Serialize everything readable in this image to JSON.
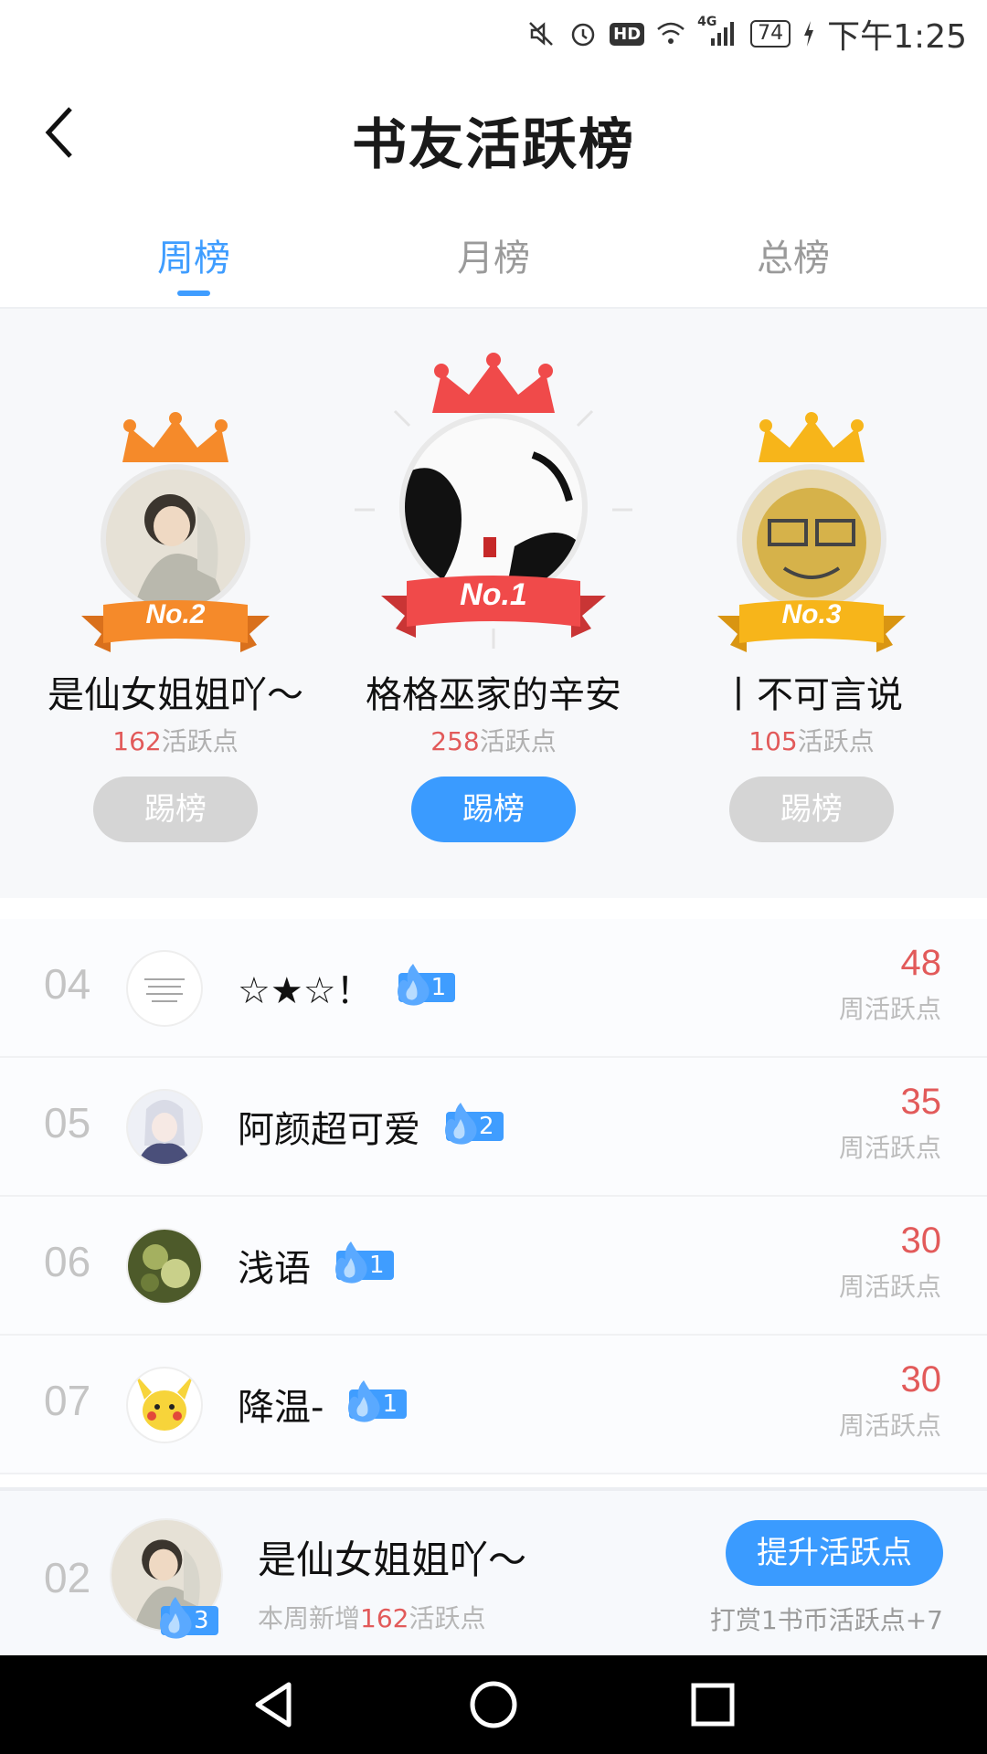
{
  "status_bar": {
    "time": "下午1:25",
    "battery": "74",
    "network": "4G",
    "hd": "HD",
    "icons": [
      "mute-icon",
      "alarm-icon",
      "hd-icon",
      "wifi-icon",
      "signal-icon",
      "battery-icon",
      "charging-icon"
    ]
  },
  "header": {
    "title": "书友活跃榜",
    "back_icon": "back-arrow-icon"
  },
  "tabs": [
    {
      "label": "周榜",
      "active": true
    },
    {
      "label": "月榜",
      "active": false
    },
    {
      "label": "总榜",
      "active": false
    }
  ],
  "podium": [
    {
      "rank_label": "No.1",
      "name": "格格巫家的辛安",
      "points": "258",
      "points_suffix": "活跃点",
      "button": "踢榜",
      "button_style": "blue",
      "crown_color": "#f04a4a",
      "ribbon_color": "#f04a4a"
    },
    {
      "rank_label": "No.2",
      "name": "是仙女姐姐吖～",
      "points": "162",
      "points_suffix": "活跃点",
      "button": "踢榜",
      "button_style": "gray",
      "crown_color": "#f58a2a",
      "ribbon_color": "#f58a2a"
    },
    {
      "rank_label": "No.3",
      "name": "丨不可言说",
      "points": "105",
      "points_suffix": "活跃点",
      "button": "踢榜",
      "button_style": "gray",
      "crown_color": "#f7b51a",
      "ribbon_color": "#f7b51a"
    }
  ],
  "list": [
    {
      "rank": "04",
      "name": "☆★☆！",
      "fire_level": "1",
      "score": "48",
      "score_label": "周活跃点"
    },
    {
      "rank": "05",
      "name": "阿颜超可爱",
      "fire_level": "2",
      "score": "35",
      "score_label": "周活跃点"
    },
    {
      "rank": "06",
      "name": "浅语",
      "fire_level": "1",
      "score": "30",
      "score_label": "周活跃点"
    },
    {
      "rank": "07",
      "name": "降温-",
      "fire_level": "1",
      "score": "30",
      "score_label": "周活跃点"
    }
  ],
  "mine": {
    "rank": "02",
    "name": "是仙女姐姐吖～",
    "fire_level": "3",
    "sub_prefix": "本周新增",
    "sub_points": "162",
    "sub_suffix": "活跃点",
    "button": "提升活跃点",
    "tip": "打赏1书币活跃点+7"
  },
  "colors": {
    "accent": "#3a9bff",
    "points_red": "#e25a5a",
    "gray_button": "#d5d5d5"
  }
}
